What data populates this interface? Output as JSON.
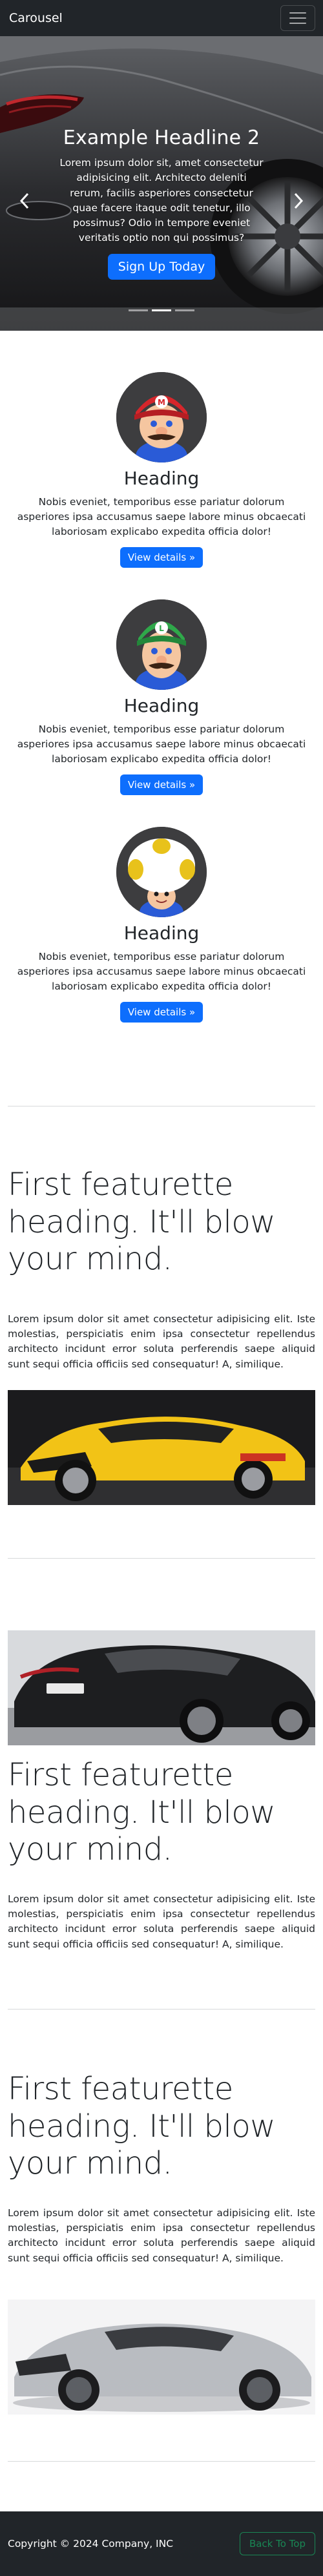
{
  "navbar": {
    "brand": "Carousel"
  },
  "carousel": {
    "headline": "Example Headline 2",
    "text": "Lorem ipsum dolor sit, amet consectetur adipisicing elit. Architecto deleniti rerum, facilis asperiores consectetur quae facere itaque odit tenetur, illo possimus? Odio in tempore eveniet veritatis optio non qui possimus?",
    "cta": "Sign Up Today",
    "slide_count": 3,
    "active_slide": 2
  },
  "marketing": [
    {
      "heading": "Heading",
      "text": "Nobis eveniet, temporibus esse pariatur dolorum asperiores ipsa accusamus saepe labore minus obcaecati laboriosam explicabo expedita officia dolor!",
      "button": "View details »",
      "character": "mario"
    },
    {
      "heading": "Heading",
      "text": "Nobis eveniet, temporibus esse pariatur dolorum asperiores ipsa accusamus saepe labore minus obcaecati laboriosam explicabo expedita officia dolor!",
      "button": "View details »",
      "character": "luigi"
    },
    {
      "heading": "Heading",
      "text": "Nobis eveniet, temporibus esse pariatur dolorum asperiores ipsa accusamus saepe labore minus obcaecati laboriosam explicabo expedita officia dolor!",
      "button": "View details »",
      "character": "toad"
    }
  ],
  "featurettes": [
    {
      "heading": "First featurette heading. It'll blow your mind.",
      "text": "Lorem ipsum dolor sit amet consectetur adipisicing elit. Iste molestias, perspiciatis enim ipsa consectetur repellendus architecto incidunt error soluta perferendis saepe aliquid sunt sequi officia officiis sed consequatur! A, similique.",
      "image": "yellow-sports-car"
    },
    {
      "heading": "First featurette heading. It'll blow your mind.",
      "text": "Lorem ipsum dolor sit amet consectetur adipisicing elit. Iste molestias, perspiciatis enim ipsa consectetur repellendus architecto incidunt error soluta perferendis saepe aliquid sunt sequi officia officiis sed consequatur! A, similique.",
      "image": "black-coupe"
    },
    {
      "heading": "First featurette heading. It'll blow your mind.",
      "text": "Lorem ipsum dolor sit amet consectetur adipisicing elit. Iste molestias, perspiciatis enim ipsa consectetur repellendus architecto incidunt error soluta perferendis saepe aliquid sunt sequi officia officiis sed consequatur! A, similique.",
      "image": "silver-gtr"
    }
  ],
  "footer": {
    "copyright": "Copyright © 2024 Company, INC",
    "back_to_top": "Back To Top"
  },
  "colors": {
    "navbar": "#212529",
    "primary": "#0d6efd",
    "success": "#198754"
  },
  "icons": {
    "menu": "hamburger-icon",
    "prev": "chevron-left-icon",
    "next": "chevron-right-icon"
  }
}
